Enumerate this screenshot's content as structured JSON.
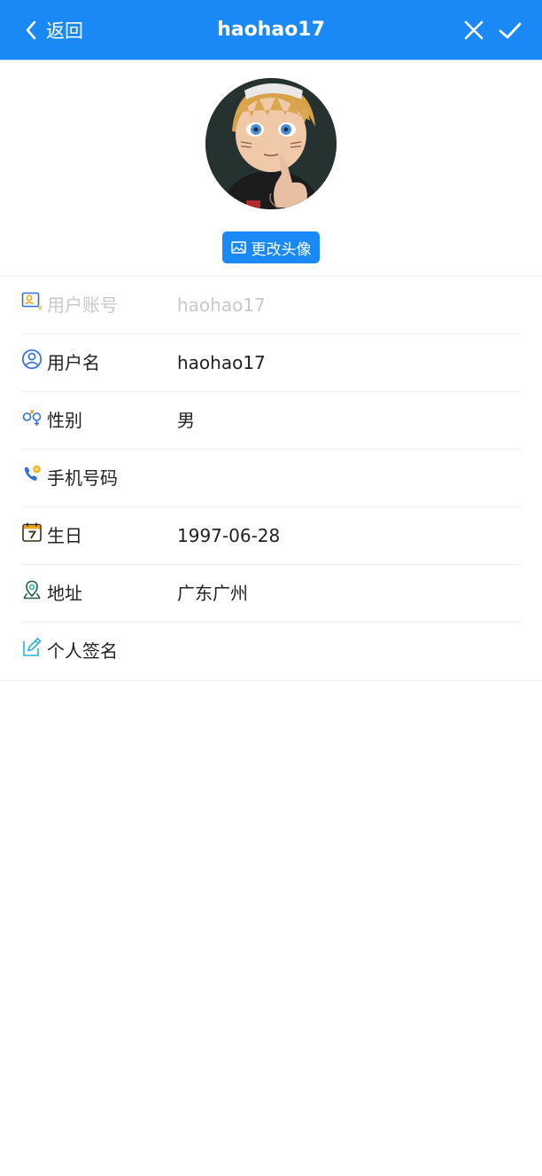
{
  "header": {
    "back_label": "返回",
    "title": "haohao17"
  },
  "avatar": {
    "change_label": "更改头像"
  },
  "fields": {
    "account": {
      "label": "用户账号",
      "value": "haohao17"
    },
    "username": {
      "label": "用户名",
      "value": "haohao17"
    },
    "gender": {
      "label": "性别",
      "value": "男"
    },
    "phone": {
      "label": "手机号码",
      "value": ""
    },
    "birthday": {
      "label": "生日",
      "value": "1997-06-28"
    },
    "address": {
      "label": "地址",
      "value": "广东广州"
    },
    "signature": {
      "label": "个人签名",
      "value": ""
    }
  },
  "colors": {
    "primary": "#1a89f5",
    "disabled_text": "#c8c8c8"
  }
}
